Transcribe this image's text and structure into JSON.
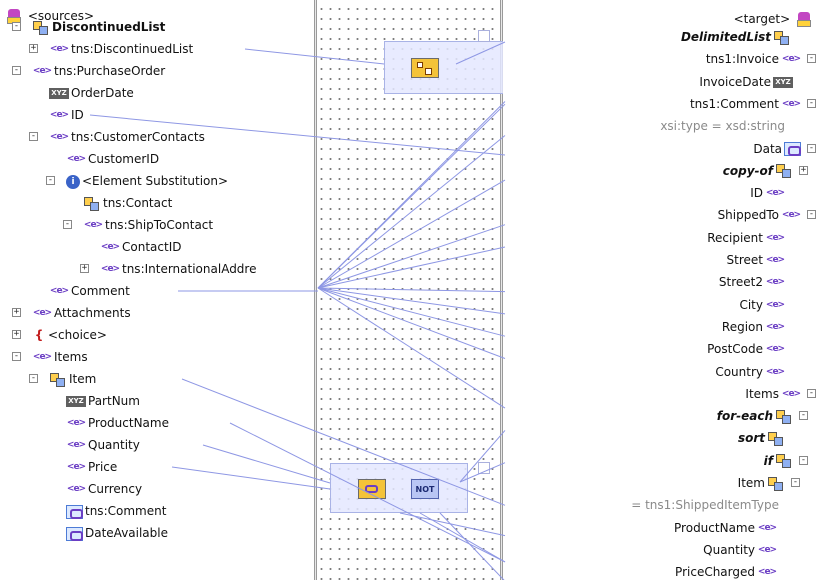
{
  "sources_label": "<sources>",
  "target_label": "<target>",
  "left_items": [
    {
      "label": "DiscontinuedList",
      "icon": "complex-type-icon",
      "bold": true
    },
    {
      "label": "tns:DiscontinuedList",
      "icon": "element-icon"
    },
    {
      "label": "tns:PurchaseOrder",
      "icon": "element-icon"
    },
    {
      "label": "OrderDate",
      "icon": "string-type-icon"
    },
    {
      "label": "ID",
      "icon": "element-icon"
    },
    {
      "label": "tns:CustomerContacts",
      "icon": "element-icon"
    },
    {
      "label": "CustomerID",
      "icon": "element-icon"
    },
    {
      "label": "<Element Substitution>",
      "icon": "info-icon"
    },
    {
      "label": "tns:Contact",
      "icon": "complex-type-icon"
    },
    {
      "label": "tns:ShipToContact",
      "icon": "element-icon"
    },
    {
      "label": "ContactID",
      "icon": "element-icon"
    },
    {
      "label": "tns:InternationalAddre",
      "icon": "element-icon"
    },
    {
      "label": "Comment",
      "icon": "element-icon"
    },
    {
      "label": "Attachments",
      "icon": "element-icon"
    },
    {
      "label": "<choice>",
      "icon": "choice-icon"
    },
    {
      "label": "Items",
      "icon": "element-icon"
    },
    {
      "label": "Item",
      "icon": "complex-type-icon"
    },
    {
      "label": "PartNum",
      "icon": "string-type-icon"
    },
    {
      "label": "ProductName",
      "icon": "element-icon"
    },
    {
      "label": "Quantity",
      "icon": "element-icon"
    },
    {
      "label": "Price",
      "icon": "element-icon"
    },
    {
      "label": "Currency",
      "icon": "element-icon"
    },
    {
      "label": "tns:Comment",
      "icon": "selected-element-icon"
    },
    {
      "label": "DateAvailable",
      "icon": "selected-element-icon"
    }
  ],
  "right_items": [
    {
      "label": "DelimitedList",
      "icon": "complex-type-icon",
      "style": "bold-italic"
    },
    {
      "label": "tns1:Invoice",
      "icon": "element-icon"
    },
    {
      "label": "InvoiceDate",
      "icon": "string-type-icon"
    },
    {
      "label": "tns1:Comment",
      "icon": "element-icon"
    },
    {
      "label": "xsi:type = xsd:string",
      "icon": "",
      "style": "gray"
    },
    {
      "label": "Data",
      "icon": "selected-element-icon"
    },
    {
      "label": "copy-of",
      "icon": "complex-type-icon",
      "style": "bold-italic"
    },
    {
      "label": "ID",
      "icon": "element-icon"
    },
    {
      "label": "ShippedTo",
      "icon": "element-icon"
    },
    {
      "label": "Recipient",
      "icon": "element-icon"
    },
    {
      "label": "Street",
      "icon": "element-icon"
    },
    {
      "label": "Street2",
      "icon": "element-icon"
    },
    {
      "label": "City",
      "icon": "element-icon"
    },
    {
      "label": "Region",
      "icon": "element-icon"
    },
    {
      "label": "PostCode",
      "icon": "element-icon"
    },
    {
      "label": "Country",
      "icon": "element-icon"
    },
    {
      "label": "Items",
      "icon": "element-icon"
    },
    {
      "label": "for-each",
      "icon": "complex-type-icon",
      "style": "bold-italic"
    },
    {
      "label": "sort",
      "icon": "complex-type-icon",
      "style": "bold-italic"
    },
    {
      "label": "if",
      "icon": "complex-type-icon",
      "style": "bold-italic"
    },
    {
      "label": "Item",
      "icon": "complex-type-icon"
    },
    {
      "label": "= tns1:ShippedItemType",
      "icon": "",
      "style": "gray"
    },
    {
      "label": "ProductName",
      "icon": "element-icon"
    },
    {
      "label": "Quantity",
      "icon": "element-icon"
    },
    {
      "label": "PriceCharged",
      "icon": "element-icon"
    }
  ],
  "functions": [
    {
      "name": "concat-function",
      "icons": [
        "concat-icon"
      ]
    },
    {
      "name": "exists-not-function",
      "icons": [
        "exists-icon",
        "not-icon"
      ],
      "not_label": "NOT"
    }
  ],
  "colors": {
    "link": "#8e97e4",
    "canvas_dot": "#7d7d7d",
    "function_box": "#e4e8ff"
  }
}
